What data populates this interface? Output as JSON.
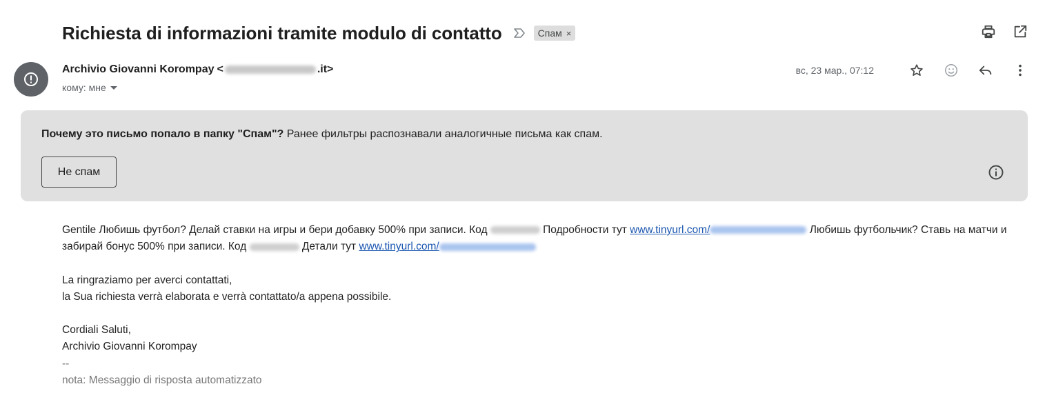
{
  "subject": "Richiesta di informazioni tramite modulo di contatto",
  "label": {
    "text": "Спам",
    "remove": "×"
  },
  "sender": {
    "name": "Archivio Giovanni Korompay",
    "email_prefix": "<",
    "email_suffix": ".it>",
    "to": "кому: мне"
  },
  "date": "вс, 23 мар., 07:12",
  "spam_banner": {
    "question": "Почему это письмо попало в папку \"Спам\"?",
    "reason": " Ранее фильтры распознавали аналогичные письма как спам.",
    "button": "Не спам"
  },
  "body": {
    "line1_a": "Gentile Любишь футбол? Делай ставки на игры и бери добавку 500% при записи. Код ",
    "line1_b": " Подробности тут ",
    "link1": "www.tinyurl.com/",
    "line1_c": " Любишь футбольчик? Ставь на матчи и забирай бонус 500% при записи. Код ",
    "line1_d": " Детали тут ",
    "link2": "www.tinyurl.com/",
    "p2_l1": "La ringraziamo per averci contattati,",
    "p2_l2": "la Sua richiesta verrà elaborata e verrà contattato/a appena possibile.",
    "p3_l1": "Cordiali Saluti,",
    "p3_l2": "Archivio Giovanni Korompay",
    "sig_sep": "--",
    "note": "nota: Messaggio di risposta automatizzato"
  },
  "colors": {
    "link": "#1a56b0",
    "banner": "#e0e0e0",
    "avatar": "#5f6368"
  },
  "icons": [
    "important-marker-icon",
    "print-icon",
    "open-in-new-window-icon",
    "spam-warning-icon",
    "dropdown-caret-icon",
    "star-icon",
    "emoji-reaction-icon",
    "reply-icon",
    "more-options-icon",
    "info-icon"
  ]
}
